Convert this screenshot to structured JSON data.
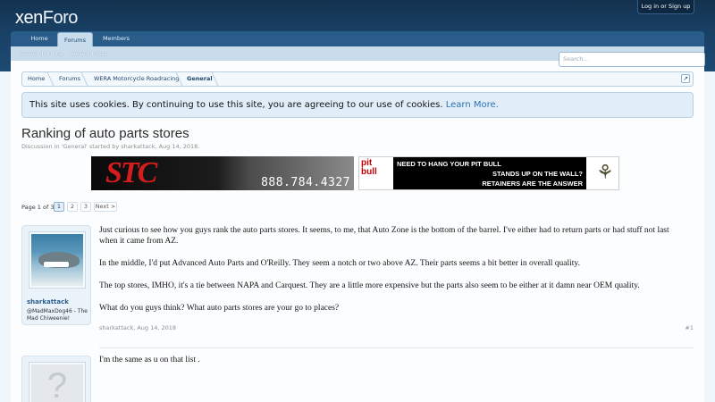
{
  "site": {
    "logo_part1": "xen",
    "logo_part2": "Foro",
    "login_label": "Log in or Sign up"
  },
  "nav": {
    "tabs": [
      "Home",
      "Forums",
      "Members"
    ],
    "sub": [
      "Search Forums",
      "Recent Posts"
    ],
    "search_placeholder": "Search..."
  },
  "breadcrumb": [
    "Home",
    "Forums",
    "WERA Motorcycle Roadracing",
    "General"
  ],
  "breadcrumb_jump_icon": "jump-arrow-icon",
  "notice": {
    "text": "This site uses cookies. By continuing to use this site, you are agreeing to our use of cookies.",
    "link": "Learn More."
  },
  "thread": {
    "title": "Ranking of auto parts stores",
    "meta": "Discussion in 'General' started by sharkattack, Aug 14, 2018."
  },
  "ads": {
    "ad1": {
      "brand": "STC",
      "phone": "888.784.4327",
      "brand_color": "#d61d1d"
    },
    "ad2": {
      "logo_top": "pit",
      "logo_bottom": "bull",
      "line1": "NEED TO HANG YOUR PIT BULL",
      "line2": "STANDS UP ON THE WALL?",
      "line3": "RETAINERS ARE THE ANSWER"
    }
  },
  "pagination": {
    "label": "Page 1 of 3",
    "pages": [
      "1",
      "2",
      "3"
    ],
    "current": "1",
    "next": "Next >"
  },
  "posts": [
    {
      "username": "sharkattack",
      "user_title": "@MadMaxDog46 - The Mad Chiweenie!",
      "paragraphs": [
        "Just curious to see how you guys rank the auto parts stores. It seems, to me, that Auto Zone is the bottom of the barrel. I've either had to return parts or had stuff not last when it came from AZ.",
        "In the middle, I'd put Advanced Auto Parts and O'Reilly. They seem a notch or two above AZ. Their parts seems a bit better in overall quality.",
        "The top stores, IMHO, it's a tie between NAPA and Carquest. They are a little more expensive but the parts also seem to be either at it damn near OEM quality.",
        "What do you guys think? What auto parts stores are your go to places?"
      ],
      "meta": "sharkattack, Aug 14, 2018",
      "number": "#1"
    },
    {
      "text": "I'm the same as u on that list .",
      "avatar_placeholder": "?"
    }
  ],
  "colors": {
    "header": "#183f63",
    "accent": "#2b5d8c",
    "link": "#2b72b3"
  }
}
